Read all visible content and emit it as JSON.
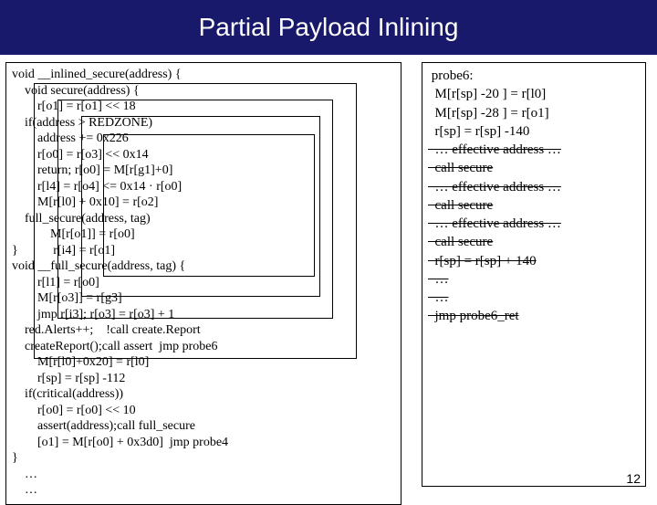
{
  "title": "Partial Payload Inlining",
  "left": {
    "l1": "void __inlined_secure(address) {",
    "l2": "    void secure(address) {",
    "l3": "        r[o1] = r[o1] << 18",
    "l4": "    if(address > REDZONE)",
    "l5": "        address += 0x226",
    "l6": "        r[o0] = r[o3] << 0x14",
    "l7": "        return; r[o0] = M[r[g1]+0]",
    "l8": "        r[l4] = r[o4] <= 0x14 · r[o0]",
    "l9": "        M[r[l0] + 0x10] = r[o2]",
    "l10": "    full_secure(address, tag)",
    "l11": "            M[r[o1]] = r[o0]",
    "l12": "}           r[i4] = r[o1]",
    "l13": "void __full_secure(address, tag) {",
    "l14": "        r[l1] = r[o0]",
    "l15": "        M[r[o3]] = r[g3]",
    "l16": "        jmp r[i3]; r[o3] = r[o3] + 1",
    "l17": "    red.Alerts++;    !call create.Report",
    "l18": "    createReport();call assert  jmp probe6",
    "l19": "        M[r[l0]+0x20] = r[l0]",
    "l20": "        r[sp] = r[sp] -112",
    "l21": "    if(critical(address))",
    "l22": "        r[o0] = r[o0] << 10",
    "l23": "        assert(address);call full_secure",
    "l24": "        [o1] = M[r[o0] + 0x3d0]  jmp probe4",
    "l25": "}",
    "l26": "    …",
    "l27": "    …"
  },
  "probe": {
    "p1": " probe6:",
    "p2": "  M[r[sp] -20 ] = r[l0]",
    "p3": "  M[r[sp] -28 ] = r[o1]",
    "p4": "  r[sp] = r[sp] -140",
    "p5": "",
    "p6": "  … effective address …",
    "p7": "  call secure",
    "p8": "  … effective address …",
    "p9": "  call secure",
    "p10": "  … effective address …",
    "p11": "  call secure",
    "p12": "",
    "p13": "  r[sp] = r[sp] + 140",
    "p14": "  …",
    "p15": "  …",
    "p16": "  jmp probe6_ret"
  },
  "page_number": "12"
}
